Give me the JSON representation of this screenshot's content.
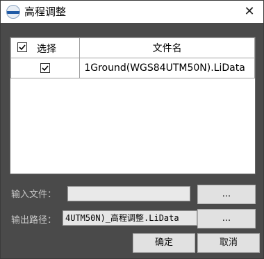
{
  "window": {
    "title": "高程调整",
    "close_glyph": "✕"
  },
  "table": {
    "headers": {
      "select": "选择",
      "file_name": "文件名"
    },
    "rows": [
      {
        "checked": true,
        "file_name": "1Ground(WGS84UTM50N).LiData"
      }
    ]
  },
  "input_file": {
    "label": "输入文件：",
    "value": "",
    "browse_label": "..."
  },
  "output_path": {
    "label": "输出路径：",
    "value": "4UTM50N)_高程调整.LiData",
    "browse_label": "..."
  },
  "buttons": {
    "ok": "确定",
    "cancel": "取消"
  },
  "colors": {
    "dialog_background": "#4a4a4a",
    "title_background": "#ffffff",
    "button_face": "#e1e1e1"
  }
}
